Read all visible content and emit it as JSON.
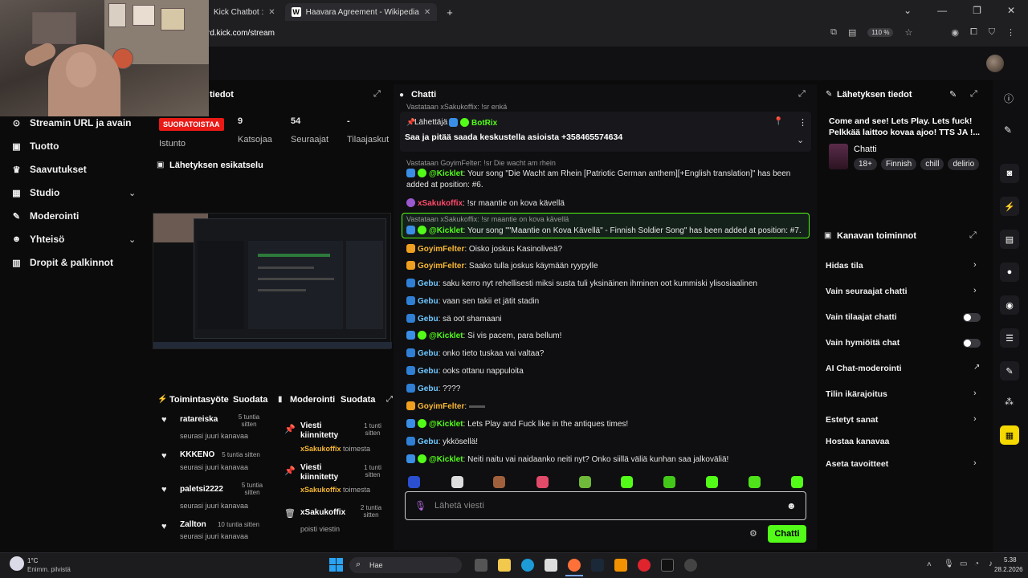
{
  "browser": {
    "tabs": [
      {
        "label": "Kick Chatbot :"
      },
      {
        "label": "Haavara Agreement - Wikipedia"
      }
    ],
    "new_tab": "+",
    "url_path": "rd.kick.com/stream",
    "zoom": "110 %"
  },
  "nav": {
    "items": [
      {
        "label": "Streamin URL ja avain",
        "icon": "cast-icon"
      },
      {
        "label": "Tuotto",
        "icon": "wallet-icon"
      },
      {
        "label": "Saavutukset",
        "icon": "trophy-icon"
      },
      {
        "label": "Studio",
        "icon": "studio-icon",
        "chevron": true
      },
      {
        "label": "Moderointi",
        "icon": "wrench-icon"
      },
      {
        "label": "Yhteisö",
        "icon": "people-icon",
        "chevron": true
      },
      {
        "label": "Dropit & palkinnot",
        "icon": "gift-icon"
      }
    ]
  },
  "stream_info": {
    "title_partial": "tiedot",
    "live_badge": "SUORATOISTAA",
    "session_label": "Istunto",
    "stats": [
      {
        "value": "9",
        "label": "Katsojaa"
      },
      {
        "value": "54",
        "label": "Seuraajat"
      },
      {
        "value": "-",
        "label": "Tilaajaskut"
      }
    ]
  },
  "preview": {
    "title": "Lähetyksen esikatselu"
  },
  "activity_feed": {
    "title": "Toimintasyöte",
    "filter": "Suodata",
    "items": [
      {
        "name": "ratareiska",
        "time": "5 tuntia sitten",
        "sub": "seurasi juuri kanavaa"
      },
      {
        "name": "KKKENO",
        "time": "5 tuntia sitten",
        "sub": "seurasi juuri kanavaa"
      },
      {
        "name": "paletsi2222",
        "time": "5 tuntia sitten",
        "sub": "seurasi juuri kanavaa"
      },
      {
        "name": "Zallton",
        "time": "10 tuntia sitten",
        "sub": "seurasi juuri kanavaa"
      }
    ]
  },
  "moderation_feed": {
    "title": "Moderointi",
    "filter": "Suodata",
    "items": [
      {
        "title": "Viesti kiinnitetty",
        "by": "xSakukoffix",
        "suffix": "toimesta",
        "time": "1 tunti sitten"
      },
      {
        "title": "Viesti kiinnitetty",
        "by": "xSakukoffix",
        "suffix": "toimesta",
        "time": "1 tunti sitten"
      },
      {
        "title": "xSakukoffix",
        "by": "",
        "suffix": "poisti viestin",
        "time": "2 tuntia sitten"
      }
    ]
  },
  "chat": {
    "title": "Chatti",
    "top_reply": "Vastataan xSakukoffix: !sr enkä",
    "pinned": {
      "label": "Lähettäjä",
      "user": "BotRix",
      "text": "Saa ja pitää saada keskustella asioista +358465574634"
    },
    "messages": [
      {
        "reply": "Vastataan GoyimFelter: !sr Die wacht am rhein",
        "user": "@Kicklet",
        "style": "bot",
        "text": "Your song \"Die Wacht am Rhein [Patriotic German anthem][+English translation]\" has been",
        "text2": "added at position: #6."
      },
      {
        "user": "xSakukoffix",
        "style": "pink",
        "text": "!sr maantie on kova kävellä"
      },
      {
        "reply": "Vastataan xSakukoffix: !sr maantie on kova kävellä",
        "user": "@Kicklet",
        "style": "bot",
        "text": "Your song \"\"Maantie on Kova Kävellä\" - Finnish Soldier Song\" has been added at position: #7."
      },
      {
        "user": "GoyimFelter",
        "style": "gold",
        "text": "Oisko joskus Kasinoliveä?"
      },
      {
        "user": "GoyimFelter",
        "style": "gold",
        "text": "Saako tulla joskus käymään ryypylle"
      },
      {
        "user": "Gebu",
        "style": "blue",
        "text": "saku kerro nyt rehellisesti miksi susta tuli yksinäinen ihminen oot kummiski ylisosiaalinen"
      },
      {
        "user": "Gebu",
        "style": "blue",
        "text": "vaan sen takii et jätit stadin"
      },
      {
        "user": "Gebu",
        "style": "blue",
        "text": "sä oot shamaani"
      },
      {
        "user": "@Kicklet",
        "style": "bot",
        "text": "Si vis pacem, para bellum!"
      },
      {
        "user": "Gebu",
        "style": "blue",
        "text": "onko tieto tuskaa vai valtaa?"
      },
      {
        "user": "Gebu",
        "style": "blue",
        "text": "ooks ottanu nappuloita"
      },
      {
        "user": "Gebu",
        "style": "blue",
        "text": "????"
      },
      {
        "user": "GoyimFelter",
        "style": "gold",
        "text": ""
      },
      {
        "user": "@Kicklet",
        "style": "bot",
        "text": "Lets Play and Fuck like in the antiques times!"
      },
      {
        "user": "Gebu",
        "style": "blue",
        "text": "ykkösellä!"
      },
      {
        "user": "@Kicklet",
        "style": "bot",
        "text": "Neiti naitu vai naidaanko neiti nyt? Onko siillä väliä kunhan saa jalkoväliä!"
      }
    ],
    "input_placeholder": "Lähetä viesti",
    "send_label": "Chatti"
  },
  "broadcast_info": {
    "title": "Lähetyksen tiedot",
    "stream_title": "Come and see! Lets Play. Lets fuck! Pelkkää laittoo kovaa ajoo! TTS JA !...",
    "category": "Chatti",
    "tags": [
      "18+",
      "Finnish",
      "chill",
      "delirio"
    ]
  },
  "channel_actions": {
    "title": "Kanavan toiminnot",
    "items": [
      {
        "label": "Hidas tila",
        "control": "chevron"
      },
      {
        "label": "Vain seuraajat chatti",
        "control": "chevron"
      },
      {
        "label": "Vain tilaajat chatti",
        "control": "toggle"
      },
      {
        "label": "Vain hymiöitä chat",
        "control": "toggle"
      },
      {
        "label": "AI Chat-moderointi",
        "control": "external"
      },
      {
        "label": "Tilin ikärajoitus",
        "control": "chevron"
      },
      {
        "label": "Estetyt sanat",
        "control": "chevron"
      },
      {
        "label": "Hostaa kanavaa",
        "control": "none"
      },
      {
        "label": "Aseta tavoitteet",
        "control": "chevron"
      }
    ]
  },
  "taskbar": {
    "weather_temp": "1°C",
    "weather_desc": "Enimm. pilvistä",
    "search_label": "Hae",
    "time": "5.38",
    "date": "28.2.2026"
  },
  "colors": {
    "accent": "#53fc18",
    "live": "#e91916",
    "gold": "#f7b733",
    "blue": "#6fc7ff"
  }
}
